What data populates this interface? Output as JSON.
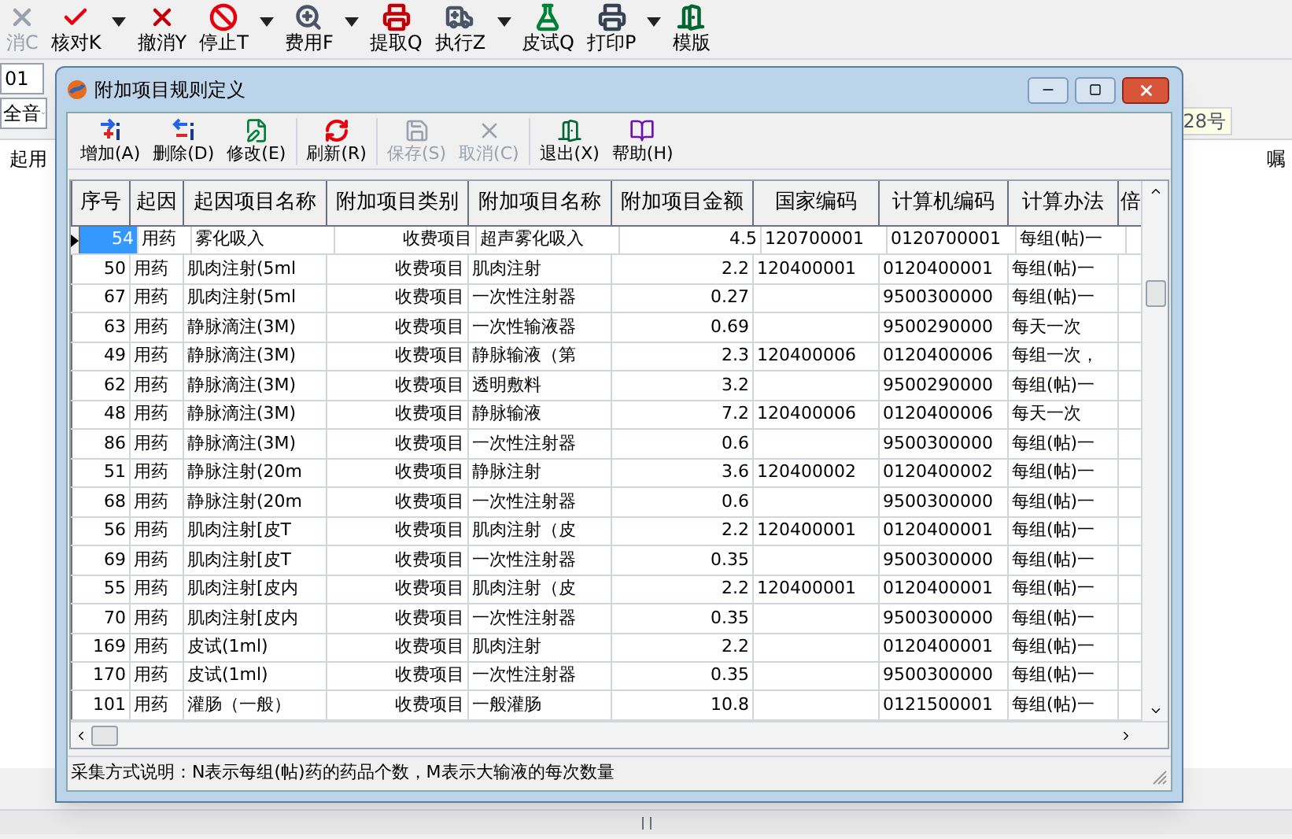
{
  "main_toolbar": [
    {
      "label": "消C",
      "disabled": true,
      "dropdown": false
    },
    {
      "label": "核对K",
      "disabled": false,
      "dropdown": true
    },
    {
      "label": "撤消Y",
      "disabled": false,
      "dropdown": false
    },
    {
      "label": "停止T",
      "disabled": false,
      "dropdown": true
    },
    {
      "label": "费用F",
      "disabled": false,
      "dropdown": true
    },
    {
      "label": "提取Q",
      "disabled": false,
      "dropdown": false
    },
    {
      "label": "执行Z",
      "disabled": false,
      "dropdown": true
    },
    {
      "label": "皮试Q",
      "disabled": false,
      "dropdown": false
    },
    {
      "label": "打印P",
      "disabled": false,
      "dropdown": true
    },
    {
      "label": "模版",
      "disabled": false,
      "dropdown": false
    }
  ],
  "background": {
    "field_value": "01",
    "combo_value": "全音",
    "right_field": "28号",
    "left_header": "起用",
    "right_header": "嘱"
  },
  "dialog": {
    "title": "附加项目规则定义",
    "toolbar": [
      {
        "label": "增加(A)",
        "disabled": false
      },
      {
        "label": "删除(D)",
        "disabled": false
      },
      {
        "label": "修改(E)",
        "disabled": false
      },
      {
        "label": "刷新(R)",
        "disabled": false
      },
      {
        "label": "保存(S)",
        "disabled": true
      },
      {
        "label": "取消(C)",
        "disabled": true
      },
      {
        "label": "退出(X)",
        "disabled": false
      },
      {
        "label": "帮助(H)",
        "disabled": false
      }
    ],
    "table": {
      "columns": [
        "序号",
        "起因",
        "起因项目名称",
        "附加项目类别",
        "附加项目名称",
        "附加项目金额",
        "国家编码",
        "计算机编码",
        "计算办法",
        "倍"
      ],
      "rows": [
        {
          "selected": true,
          "cells": [
            "54",
            "用药",
            "雾化吸入",
            "收费项目",
            "超声雾化吸入",
            "4.5",
            "120700001",
            "0120700001",
            "每组(帖)一"
          ]
        },
        {
          "selected": false,
          "cells": [
            "50",
            "用药",
            "肌肉注射(5ml",
            "收费项目",
            "肌肉注射",
            "2.2",
            "120400001",
            "0120400001",
            "每组(帖)一"
          ]
        },
        {
          "selected": false,
          "cells": [
            "67",
            "用药",
            "肌肉注射(5ml",
            "收费项目",
            "一次性注射器",
            "0.27",
            "",
            "9500300000",
            "每组(帖)一"
          ]
        },
        {
          "selected": false,
          "cells": [
            "63",
            "用药",
            "静脉滴注(3M)",
            "收费项目",
            "一次性输液器",
            "0.69",
            "",
            "9500290000",
            "每天一次"
          ]
        },
        {
          "selected": false,
          "cells": [
            "49",
            "用药",
            "静脉滴注(3M)",
            "收费项目",
            "静脉输液（第",
            "2.3",
            "120400006",
            "0120400006",
            "每组一次，"
          ]
        },
        {
          "selected": false,
          "cells": [
            "62",
            "用药",
            "静脉滴注(3M)",
            "收费项目",
            "透明敷料",
            "3.2",
            "",
            "9500290000",
            "每组(帖)一"
          ]
        },
        {
          "selected": false,
          "cells": [
            "48",
            "用药",
            "静脉滴注(3M)",
            "收费项目",
            "静脉输液",
            "7.2",
            "120400006",
            "0120400006",
            "每天一次"
          ]
        },
        {
          "selected": false,
          "cells": [
            "86",
            "用药",
            "静脉滴注(3M)",
            "收费项目",
            "一次性注射器",
            "0.6",
            "",
            "9500300000",
            "每组(帖)一"
          ]
        },
        {
          "selected": false,
          "cells": [
            "51",
            "用药",
            "静脉注射(20m",
            "收费项目",
            "静脉注射",
            "3.6",
            "120400002",
            "0120400002",
            "每组(帖)一"
          ]
        },
        {
          "selected": false,
          "cells": [
            "68",
            "用药",
            "静脉注射(20m",
            "收费项目",
            "一次性注射器",
            "0.6",
            "",
            "9500300000",
            "每组(帖)一"
          ]
        },
        {
          "selected": false,
          "cells": [
            "56",
            "用药",
            "肌肉注射[皮T",
            "收费项目",
            "肌肉注射（皮",
            "2.2",
            "120400001",
            "0120400001",
            "每组(帖)一"
          ]
        },
        {
          "selected": false,
          "cells": [
            "69",
            "用药",
            "肌肉注射[皮T",
            "收费项目",
            "一次性注射器",
            "0.35",
            "",
            "9500300000",
            "每组(帖)一"
          ]
        },
        {
          "selected": false,
          "cells": [
            "55",
            "用药",
            "肌肉注射[皮内",
            "收费项目",
            "肌肉注射（皮",
            "2.2",
            "120400001",
            "0120400001",
            "每组(帖)一"
          ]
        },
        {
          "selected": false,
          "cells": [
            "70",
            "用药",
            "肌肉注射[皮内",
            "收费项目",
            "一次性注射器",
            "0.35",
            "",
            "9500300000",
            "每组(帖)一"
          ]
        },
        {
          "selected": false,
          "cells": [
            "169",
            "用药",
            "皮试(1ml)",
            "收费项目",
            "肌肉注射",
            "2.2",
            "",
            "0120400001",
            "每组(帖)一"
          ]
        },
        {
          "selected": false,
          "cells": [
            "170",
            "用药",
            "皮试(1ml)",
            "收费项目",
            "一次性注射器",
            "0.35",
            "",
            "9500300000",
            "每组(帖)一"
          ]
        },
        {
          "selected": false,
          "cells": [
            "101",
            "用药",
            "灌肠（一般）",
            "收费项目",
            "一般灌肠",
            "10.8",
            "",
            "0121500001",
            "每组(帖)一"
          ]
        }
      ]
    },
    "status_text": "采集方式说明：N表示每组(帖)药的药品个数，M表示大输液的每次数量"
  }
}
